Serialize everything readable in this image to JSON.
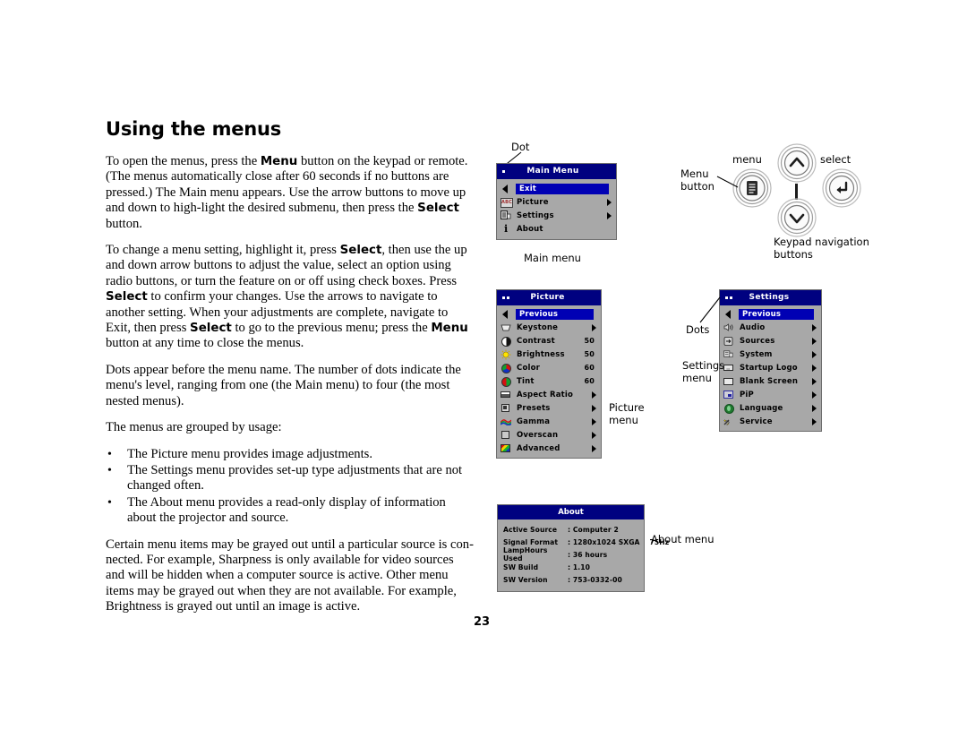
{
  "page": {
    "number": "23"
  },
  "article": {
    "title": "Using the menus",
    "paragraphs": [
      "To open the menus, press the <b>Menu</b> button on the keypad or remote. (The menus automatically close after 60 seconds if no buttons are pressed.) The Main menu appears. Use the arrow buttons to move up and down to high-light the desired submenu, then press the <b>Select</b> button.",
      "To change a menu setting, highlight it, press <b>Select</b>, then use the up and down arrow buttons to adjust the value, select an option using radio buttons, or turn the feature on or off using check boxes. Press <b>Select</b> to confirm your changes. Use the arrows to navigate to another setting. When your adjustments are complete, navigate to Exit, then press <b>Select</b> to go to the previous menu; press the <b>Menu</b> button at any time to close the menus.",
      "Dots appear before the menu name. The number of dots indicate the menu's level, ranging from one (the Main menu) to four (the most nested menus).",
      "The menus are grouped by usage:"
    ],
    "bullets": [
      "The Picture menu provides image adjustments.",
      "The Settings menu provides set-up type adjustments that are not changed often.",
      "The About menu provides a read-only display of information about the projector and source."
    ],
    "closing": "Certain menu items may be grayed out until a particular source is con-nected. For example, Sharpness is only available for video sources and will be hidden when a computer source is active. Other menu items may be grayed out when they are not available. For example, Brightness is grayed out until an image is active."
  },
  "callouts": {
    "dot": "Dot",
    "dots": "Dots",
    "main_menu": "Main menu",
    "picture_menu": "Picture\nmenu",
    "settings_menu": "Settings\nmenu",
    "about_menu": "About menu",
    "menu_button": "Menu\nbutton",
    "menu_small": "menu",
    "select_small": "select",
    "keypad_nav": "Keypad navigation\nbuttons"
  },
  "colors": {
    "title_bar": "#000180",
    "highlight": "#0000b4",
    "menu_body": "#a8a8a8"
  },
  "main_menu": {
    "title": "Main Menu",
    "level_dots": 1,
    "items": [
      {
        "label": "Exit",
        "icon": "triangle-left-icon",
        "selected": true,
        "arrow": false
      },
      {
        "label": "Picture",
        "icon": "abc-icon",
        "selected": false,
        "arrow": true
      },
      {
        "label": "Settings",
        "icon": "settings-list-icon",
        "selected": false,
        "arrow": true
      },
      {
        "label": "About",
        "icon": "info-icon",
        "selected": false,
        "arrow": false
      }
    ]
  },
  "picture_menu": {
    "title": "Picture",
    "level_dots": 2,
    "items": [
      {
        "label": "Previous",
        "icon": "triangle-left-icon",
        "selected": true,
        "arrow": false,
        "value": ""
      },
      {
        "label": "Keystone",
        "icon": "keystone-icon",
        "selected": false,
        "arrow": true,
        "value": ""
      },
      {
        "label": "Contrast",
        "icon": "contrast-icon",
        "selected": false,
        "arrow": false,
        "value": "50"
      },
      {
        "label": "Brightness",
        "icon": "brightness-icon",
        "selected": false,
        "arrow": false,
        "value": "50"
      },
      {
        "label": "Color",
        "icon": "color-icon",
        "selected": false,
        "arrow": false,
        "value": "60"
      },
      {
        "label": "Tint",
        "icon": "tint-icon",
        "selected": false,
        "arrow": false,
        "value": "60"
      },
      {
        "label": "Aspect Ratio",
        "icon": "aspect-ratio-icon",
        "selected": false,
        "arrow": true,
        "value": ""
      },
      {
        "label": "Presets",
        "icon": "presets-icon",
        "selected": false,
        "arrow": true,
        "value": ""
      },
      {
        "label": "Gamma",
        "icon": "gamma-icon",
        "selected": false,
        "arrow": true,
        "value": ""
      },
      {
        "label": "Overscan",
        "icon": "overscan-icon",
        "selected": false,
        "arrow": true,
        "value": ""
      },
      {
        "label": "Advanced",
        "icon": "advanced-icon",
        "selected": false,
        "arrow": true,
        "value": ""
      }
    ]
  },
  "settings_menu": {
    "title": "Settings",
    "level_dots": 2,
    "items": [
      {
        "label": "Previous",
        "icon": "triangle-left-icon",
        "selected": true,
        "arrow": false
      },
      {
        "label": "Audio",
        "icon": "audio-icon",
        "selected": false,
        "arrow": true
      },
      {
        "label": "Sources",
        "icon": "sources-icon",
        "selected": false,
        "arrow": true
      },
      {
        "label": "System",
        "icon": "system-icon",
        "selected": false,
        "arrow": true
      },
      {
        "label": "Startup Logo",
        "icon": "startup-logo-icon",
        "selected": false,
        "arrow": true
      },
      {
        "label": "Blank Screen",
        "icon": "blank-screen-icon",
        "selected": false,
        "arrow": true
      },
      {
        "label": "PiP",
        "icon": "pip-icon",
        "selected": false,
        "arrow": true
      },
      {
        "label": "Language",
        "icon": "language-icon",
        "selected": false,
        "arrow": true
      },
      {
        "label": "Service",
        "icon": "service-icon",
        "selected": false,
        "arrow": true
      }
    ]
  },
  "about_menu": {
    "title": "About",
    "rows": [
      {
        "key": "Active Source",
        "value": ": Computer 2"
      },
      {
        "key": "Signal Format",
        "value": ": 1280x1024 SXGA    75Hz"
      },
      {
        "key": "LampHours Used",
        "value": ": 36 hours"
      },
      {
        "key": "SW Build",
        "value": ": 1.10"
      },
      {
        "key": "SW Version",
        "value": ": 753-0332-00"
      }
    ]
  }
}
